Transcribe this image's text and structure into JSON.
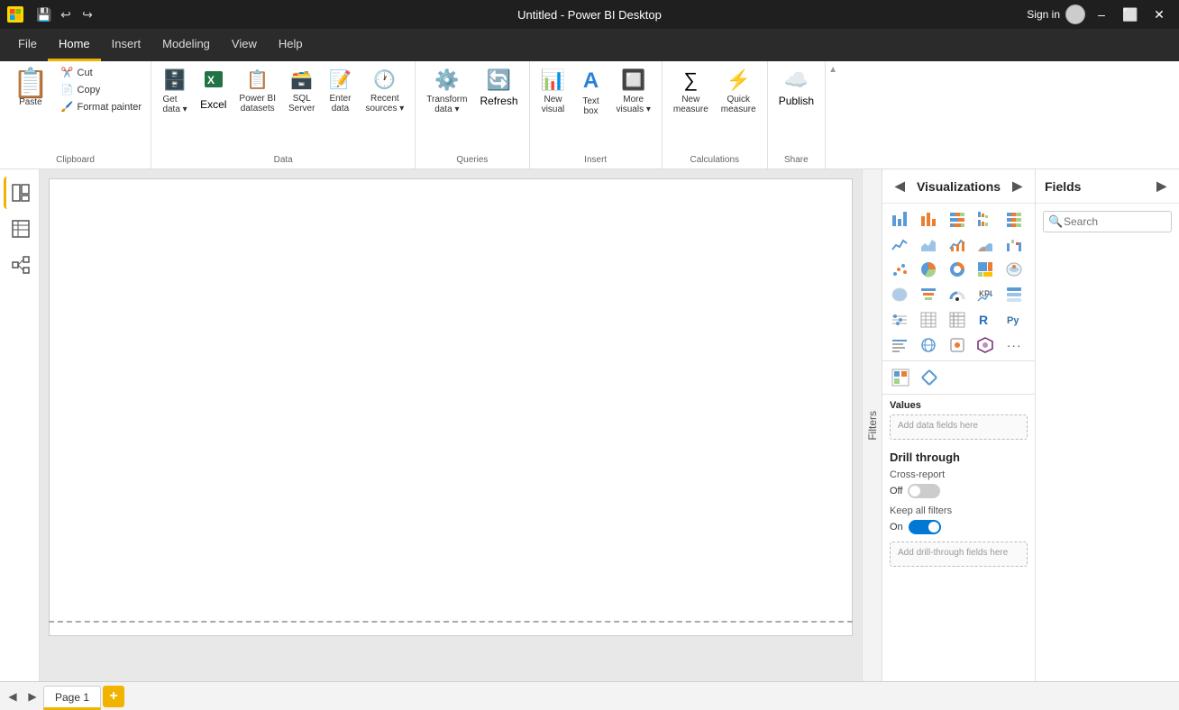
{
  "titlebar": {
    "title": "Untitled - Power BI Desktop",
    "sign_in_label": "Sign in",
    "undo_tooltip": "Undo",
    "redo_tooltip": "Redo",
    "save_tooltip": "Save"
  },
  "menubar": {
    "items": [
      {
        "id": "file",
        "label": "File"
      },
      {
        "id": "home",
        "label": "Home",
        "active": true
      },
      {
        "id": "insert",
        "label": "Insert"
      },
      {
        "id": "modeling",
        "label": "Modeling"
      },
      {
        "id": "view",
        "label": "View"
      },
      {
        "id": "help",
        "label": "Help"
      }
    ]
  },
  "ribbon": {
    "groups": [
      {
        "id": "clipboard",
        "label": "Clipboard",
        "buttons": [
          {
            "id": "paste",
            "label": "Paste",
            "icon": "📋",
            "size": "large"
          },
          {
            "id": "cut",
            "label": "Cut",
            "icon": "✂️",
            "size": "small"
          },
          {
            "id": "copy",
            "label": "Copy",
            "icon": "📄",
            "size": "small"
          },
          {
            "id": "format-painter",
            "label": "Format painter",
            "icon": "🖌️",
            "size": "small"
          }
        ]
      },
      {
        "id": "data",
        "label": "Data",
        "buttons": [
          {
            "id": "get-data",
            "label": "Get data",
            "icon": "🗄️",
            "has_dropdown": true
          },
          {
            "id": "excel",
            "label": "Excel",
            "icon": "📊"
          },
          {
            "id": "power-bi-datasets",
            "label": "Power BI datasets",
            "icon": "📋"
          },
          {
            "id": "sql-server",
            "label": "SQL Server",
            "icon": "🗃️"
          },
          {
            "id": "enter-data",
            "label": "Enter data",
            "icon": "📝"
          },
          {
            "id": "recent-sources",
            "label": "Recent sources",
            "icon": "🕐",
            "has_dropdown": true
          }
        ]
      },
      {
        "id": "queries",
        "label": "Queries",
        "buttons": [
          {
            "id": "transform-data",
            "label": "Transform data",
            "icon": "⚙️",
            "has_dropdown": true
          },
          {
            "id": "refresh",
            "label": "Refresh",
            "icon": "🔄"
          }
        ]
      },
      {
        "id": "insert",
        "label": "Insert",
        "buttons": [
          {
            "id": "new-visual",
            "label": "New visual",
            "icon": "📊"
          },
          {
            "id": "text-box",
            "label": "Text box",
            "icon": "T"
          },
          {
            "id": "more-visuals",
            "label": "More visuals",
            "icon": "🔲",
            "has_dropdown": true
          }
        ]
      },
      {
        "id": "calculations",
        "label": "Calculations",
        "buttons": [
          {
            "id": "new-measure",
            "label": "New measure",
            "icon": "∑"
          },
          {
            "id": "quick-measure",
            "label": "Quick measure",
            "icon": "⚡"
          }
        ]
      },
      {
        "id": "share",
        "label": "Share",
        "buttons": [
          {
            "id": "publish",
            "label": "Publish",
            "icon": "☁️"
          }
        ]
      }
    ]
  },
  "left_nav": {
    "items": [
      {
        "id": "report",
        "icon": "📊",
        "label": "Report view",
        "active": true
      },
      {
        "id": "data",
        "icon": "⊞",
        "label": "Data view"
      },
      {
        "id": "model",
        "icon": "🔗",
        "label": "Model view"
      }
    ]
  },
  "visualizations_panel": {
    "title": "Visualizations",
    "icons": [
      {
        "id": "bar-chart",
        "unicode": "📊"
      },
      {
        "id": "column-chart",
        "unicode": "📈"
      },
      {
        "id": "stacked-bar",
        "unicode": "▦"
      },
      {
        "id": "stacked-column",
        "unicode": "▧"
      },
      {
        "id": "clustered-bar",
        "unicode": "▤"
      },
      {
        "id": "100pct-bar",
        "unicode": "▥"
      },
      {
        "id": "line-chart",
        "unicode": "📉"
      },
      {
        "id": "area-chart",
        "unicode": "〰"
      },
      {
        "id": "line-cluster",
        "unicode": "≋"
      },
      {
        "id": "ribbon-chart",
        "unicode": "🎗"
      },
      {
        "id": "waterfall",
        "unicode": "⫾"
      },
      {
        "id": "scatter",
        "unicode": "⁚"
      },
      {
        "id": "pie-chart",
        "unicode": "◕"
      },
      {
        "id": "donut",
        "unicode": "○"
      },
      {
        "id": "treemap",
        "unicode": "▦"
      },
      {
        "id": "map",
        "unicode": "🗺"
      },
      {
        "id": "filled-map",
        "unicode": "🗾"
      },
      {
        "id": "funnel",
        "unicode": "⌁"
      },
      {
        "id": "gauge",
        "unicode": "◑"
      },
      {
        "id": "multi-row-card",
        "unicode": "▤"
      },
      {
        "id": "kpi",
        "unicode": "📶"
      },
      {
        "id": "slicer",
        "unicode": "☰"
      },
      {
        "id": "table",
        "unicode": "⊟"
      },
      {
        "id": "matrix",
        "unicode": "⊞"
      },
      {
        "id": "r-visual",
        "unicode": "R"
      },
      {
        "id": "py-visual",
        "unicode": "Py"
      },
      {
        "id": "azure-map",
        "unicode": "🗺"
      },
      {
        "id": "decomp-tree",
        "unicode": "🌲"
      },
      {
        "id": "qa",
        "unicode": "Q"
      },
      {
        "id": "globe",
        "unicode": "🌐"
      },
      {
        "id": "custom1",
        "unicode": "⊡"
      },
      {
        "id": "filters-visual",
        "unicode": "▽"
      },
      {
        "id": "card",
        "unicode": "▭"
      },
      {
        "id": "power-apps",
        "unicode": "⬡"
      },
      {
        "id": "more",
        "unicode": "···"
      }
    ],
    "format_tab": "Format",
    "data_tab": "Data",
    "values_section": {
      "label": "Values",
      "placeholder": "Add data fields here"
    },
    "drill_through": {
      "label": "Drill through",
      "cross_report_label": "Cross-report",
      "toggle_off_label": "Off",
      "toggle_on_label": "On",
      "keep_all_filters_label": "Keep all filters",
      "keep_all_filters_value": "On",
      "add_fields_placeholder": "Add drill-through fields here"
    }
  },
  "fields_panel": {
    "title": "Fields",
    "search_placeholder": "Search"
  },
  "page_tabs": {
    "pages": [
      {
        "id": "page1",
        "label": "Page 1",
        "active": true
      }
    ],
    "add_label": "+"
  },
  "filters_panel": {
    "label": "Filters"
  }
}
